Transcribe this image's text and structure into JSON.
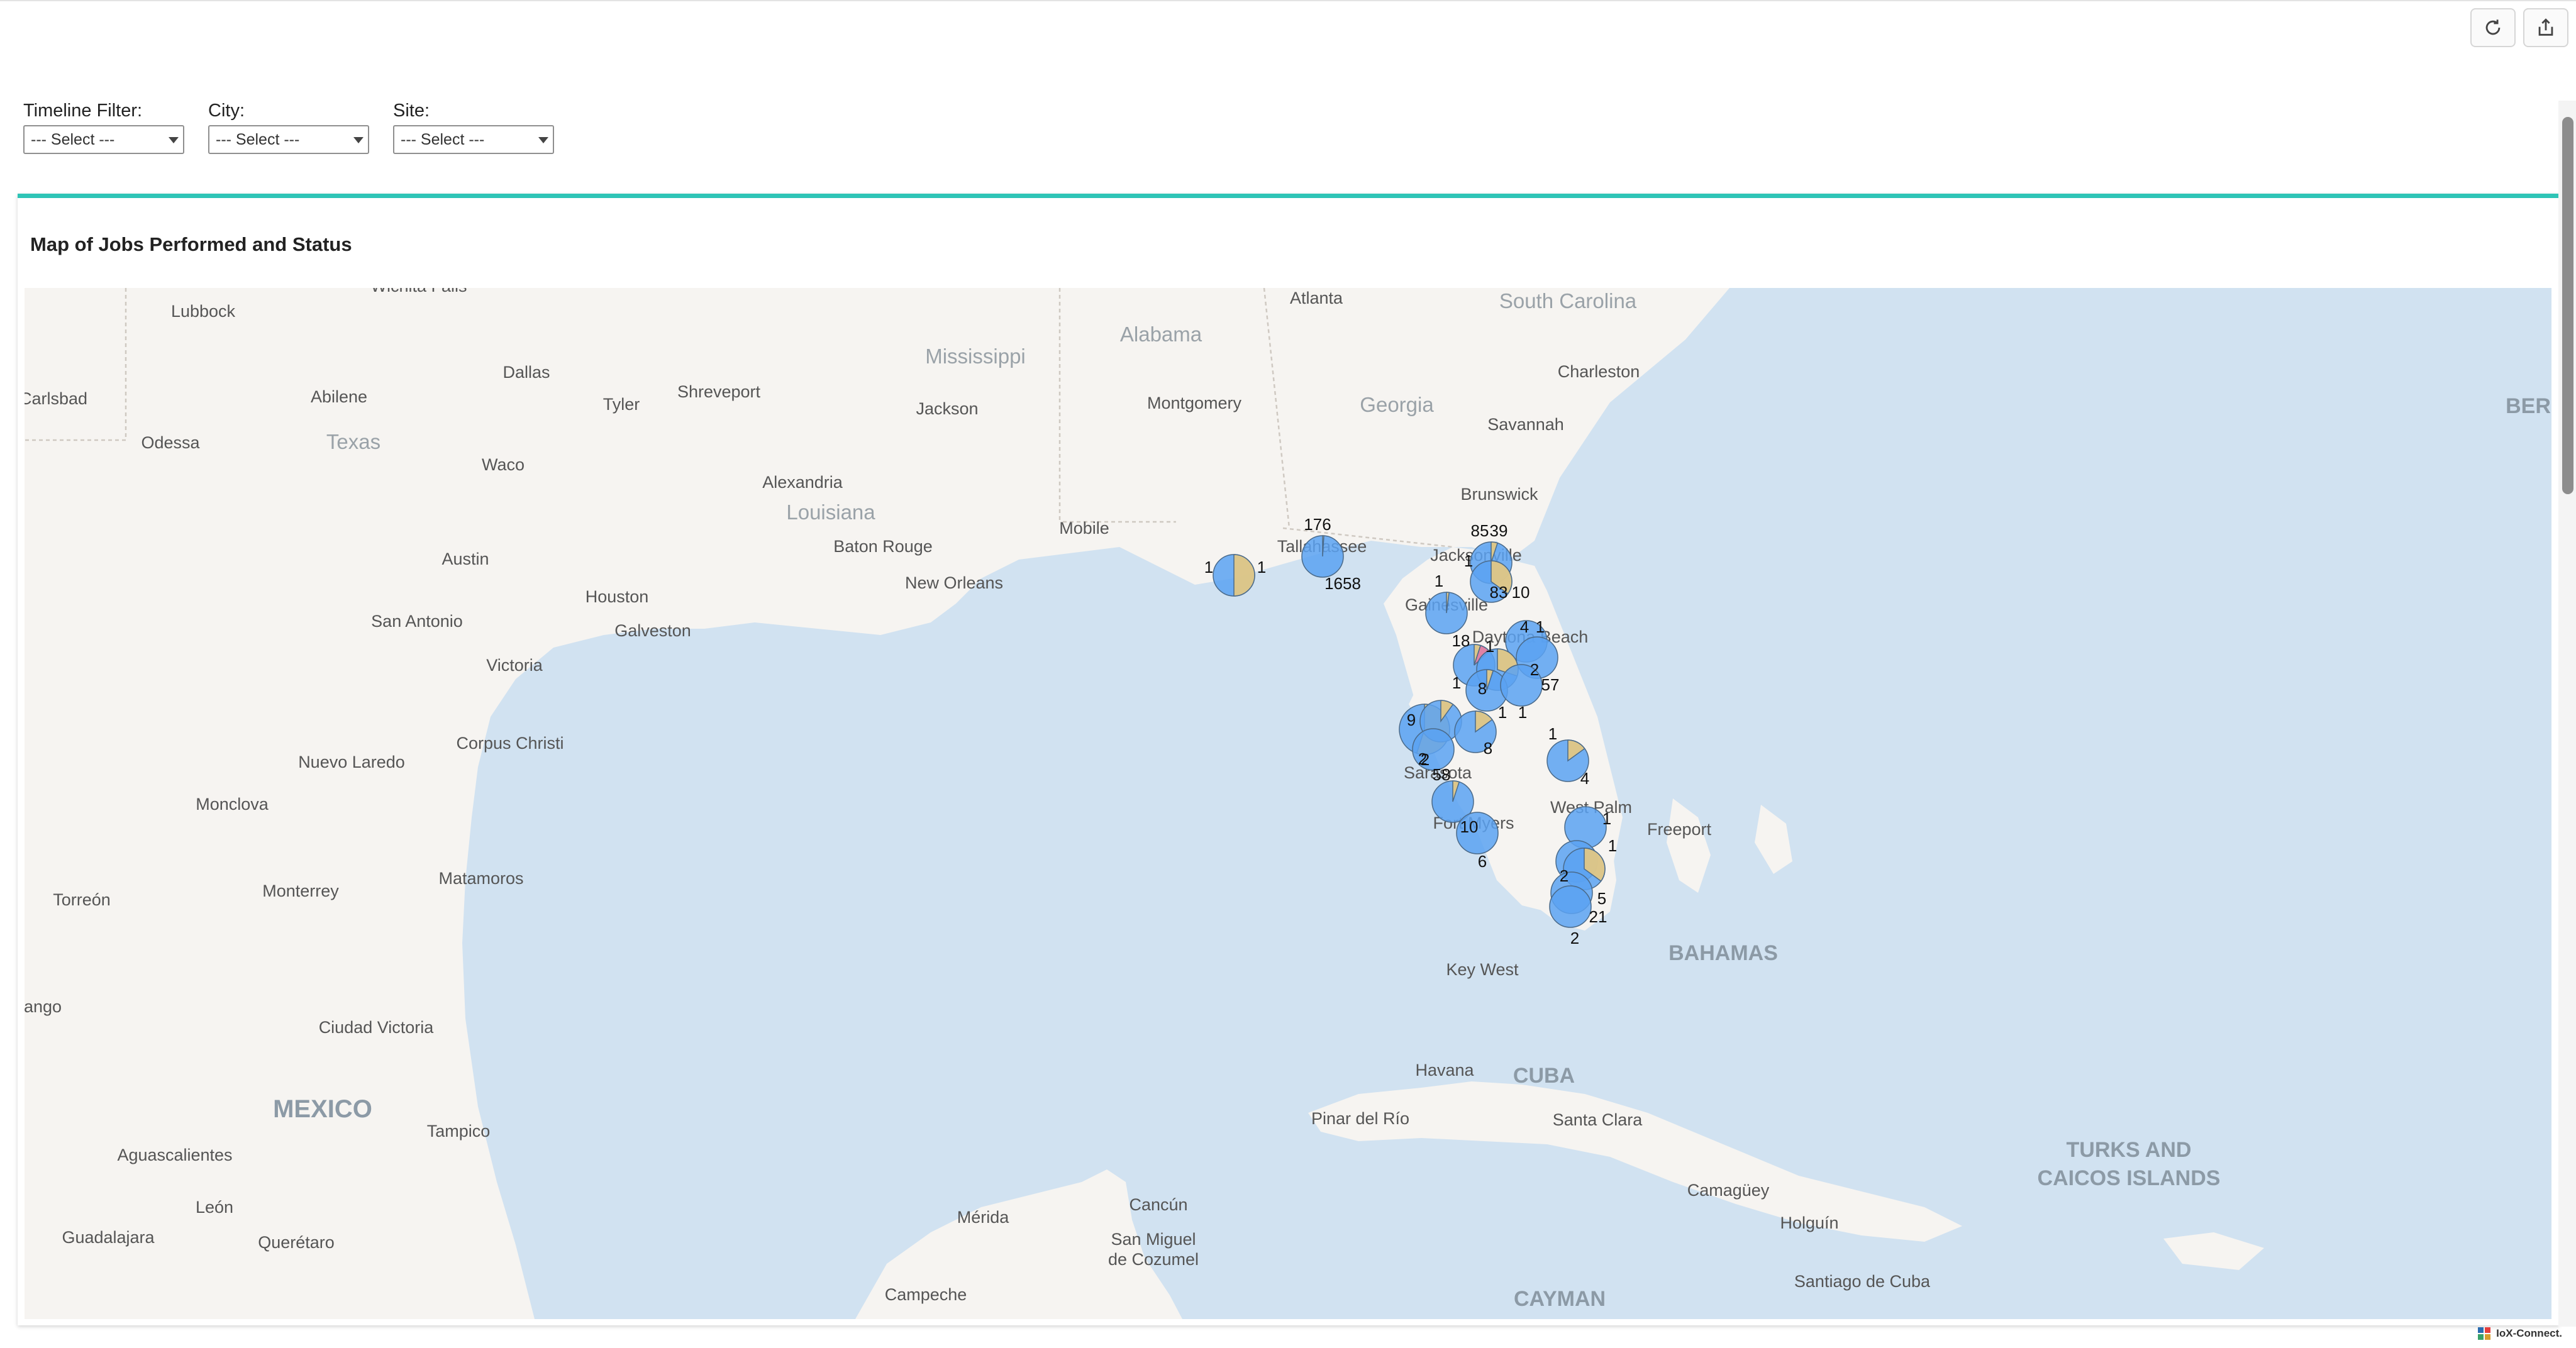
{
  "toolbar": {
    "refresh_icon": "refresh-icon",
    "export_icon": "export-icon"
  },
  "filters": [
    {
      "label": "Timeline Filter:",
      "value": "--- Select ---"
    },
    {
      "label": "City:",
      "value": "--- Select ---"
    },
    {
      "label": "Site:",
      "value": "--- Select ---"
    }
  ],
  "card": {
    "title": "Map of Jobs Performed and Status"
  },
  "map": {
    "water_color": "#d1e2f1",
    "land_color": "#f6f4f1",
    "marker_colors": {
      "blue": "#5aa2f2",
      "yellow": "#e8c97e",
      "pink": "#ec7d9c"
    },
    "country_labels": [
      "MEXICO",
      "CUBA",
      "BAHAMAS",
      "TURKS AND",
      "CAICOS ISLANDS",
      "CAYMAN",
      "BER"
    ],
    "state_labels": [
      "Texas",
      "Louisiana",
      "Mississippi",
      "Alabama",
      "Georgia",
      "South Carolina"
    ],
    "city_labels": [
      "Wichita Falls",
      "Lubbock",
      "Carlsbad",
      "Abilene",
      "Dallas",
      "Tyler",
      "Shreveport",
      "Jackson",
      "Montgomery",
      "Atlanta",
      "Charleston",
      "Savannah",
      "Odessa",
      "Waco",
      "Alexandria",
      "Brunswick",
      "Austin",
      "Baton Rouge",
      "Mobile",
      "New Orleans",
      "Tallahassee",
      "Jacksonville",
      "San Antonio",
      "Houston",
      "Galveston",
      "Gainesville",
      "Daytona Beach",
      "Victoria",
      "Corpus Christi",
      "Nuevo Laredo",
      "Monclova",
      "Sarasota",
      "West Palm",
      "Freeport",
      "Fort Myers",
      "Matamoros",
      "Torreón",
      "Monterrey",
      "Key West",
      "Ciudad Victoria",
      "ango",
      "Havana",
      "Pinar del Río",
      "Santa Clara",
      "Tampico",
      "Aguascalientes",
      "León",
      "Guadalajara",
      "Querétaro",
      "Mérida",
      "Cancún",
      "San Miguel",
      "de Cozumel",
      "Camagüey",
      "Holguín",
      "Santiago de Cuba",
      "Campeche"
    ],
    "marker_labels": [
      "176",
      "1658",
      "1",
      "1",
      "85",
      "39",
      "1",
      "83",
      "10",
      "1",
      "18",
      "1",
      "4",
      "1",
      "2",
      "1",
      "57",
      "8",
      "1",
      "1",
      "2",
      "9",
      "8",
      "2",
      "58",
      "1",
      "4",
      "10",
      "6",
      "1",
      "2",
      "5",
      "21",
      "2",
      "1"
    ]
  },
  "footer": {
    "brand": "IoX-Connect."
  }
}
